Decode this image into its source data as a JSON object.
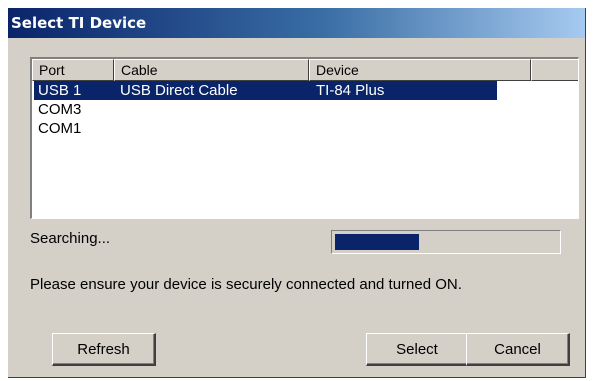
{
  "window": {
    "title": "Select TI Device"
  },
  "device_list": {
    "columns": [
      "Port",
      "Cable",
      "Device"
    ],
    "rows": [
      {
        "port": "USB 1",
        "cable": "USB Direct Cable",
        "device": "TI-84 Plus",
        "selected": true
      },
      {
        "port": "COM3",
        "cable": "",
        "device": "",
        "selected": false
      },
      {
        "port": "COM1",
        "cable": "",
        "device": "",
        "selected": false
      }
    ]
  },
  "status": {
    "label": "Searching...",
    "progress": 0.38,
    "message": "Please ensure your device is securely connected and turned ON."
  },
  "buttons": {
    "refresh": "Refresh",
    "select": "Select",
    "cancel": "Cancel"
  },
  "colors": {
    "title_bar_start": "#0a246a",
    "title_bar_end": "#a6caf0",
    "selection": "#0a246a",
    "progress_fill": "#0a246a",
    "dialog_face": "#d4d0c8"
  }
}
